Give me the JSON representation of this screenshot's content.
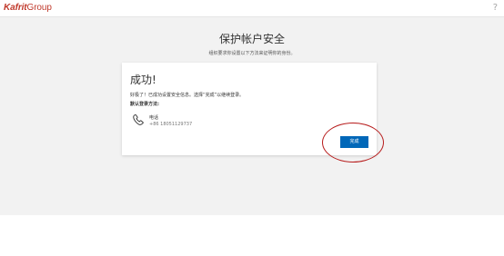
{
  "header": {
    "logo_part1": "Kafrit",
    "logo_part2": "Group",
    "help_label": "?"
  },
  "main": {
    "title": "保护帐户安全",
    "subtitle": "组织要求你设置以下方法来证明你的身份。"
  },
  "card": {
    "heading": "成功!",
    "message": "好极了！已成功设置安全信息。选择“完成”以继续登录。",
    "default_method_label": "默认登录方法:",
    "method": {
      "icon": "phone-icon",
      "label": "电话",
      "value": "+86 18051129737"
    },
    "done_label": "完成"
  },
  "colors": {
    "brand": "#c0392b",
    "button": "#0067b8",
    "annotation": "#b71c1c",
    "background": "#f2f2f2"
  }
}
